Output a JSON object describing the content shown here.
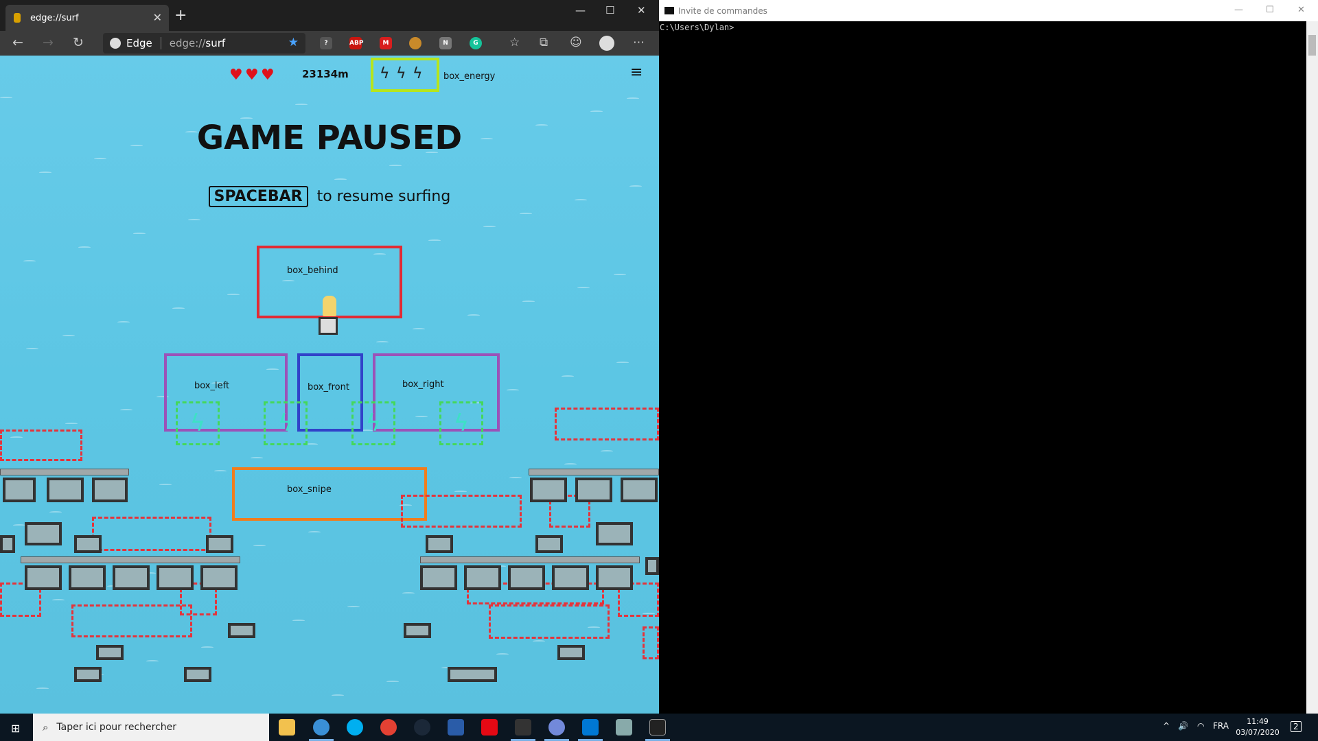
{
  "browser": {
    "tab_title": "edge://surf",
    "browser_name": "Edge",
    "url_prefix": "edge://",
    "url_path": "surf",
    "extensions": [
      "ABP",
      "M",
      "N",
      "G"
    ]
  },
  "game": {
    "distance": "23134m",
    "hearts": 3,
    "bolts": 3,
    "paused_title": "GAME PAUSED",
    "key_label": "SPACEBAR",
    "resume_text": "to resume surfing",
    "boxes": {
      "energy": "box_energy",
      "behind": "box_behind",
      "left": "box_left",
      "front": "box_front",
      "right": "box_right",
      "snipe": "box_snipe"
    }
  },
  "console": {
    "title": "Invite de commandes",
    "prompt": "C:\\Users\\Dylan>"
  },
  "taskbar": {
    "search_placeholder": "Taper ici pour rechercher",
    "language": "FRA",
    "time": "11:49",
    "date": "03/07/2020",
    "notifications": "2"
  },
  "colors": {
    "box_energy": "#b6e51d",
    "box_behind": "#e22a33",
    "box_left": "#9b52b8",
    "box_front": "#3142c9",
    "box_right": "#9b52b8",
    "box_snipe": "#f07d1d"
  }
}
